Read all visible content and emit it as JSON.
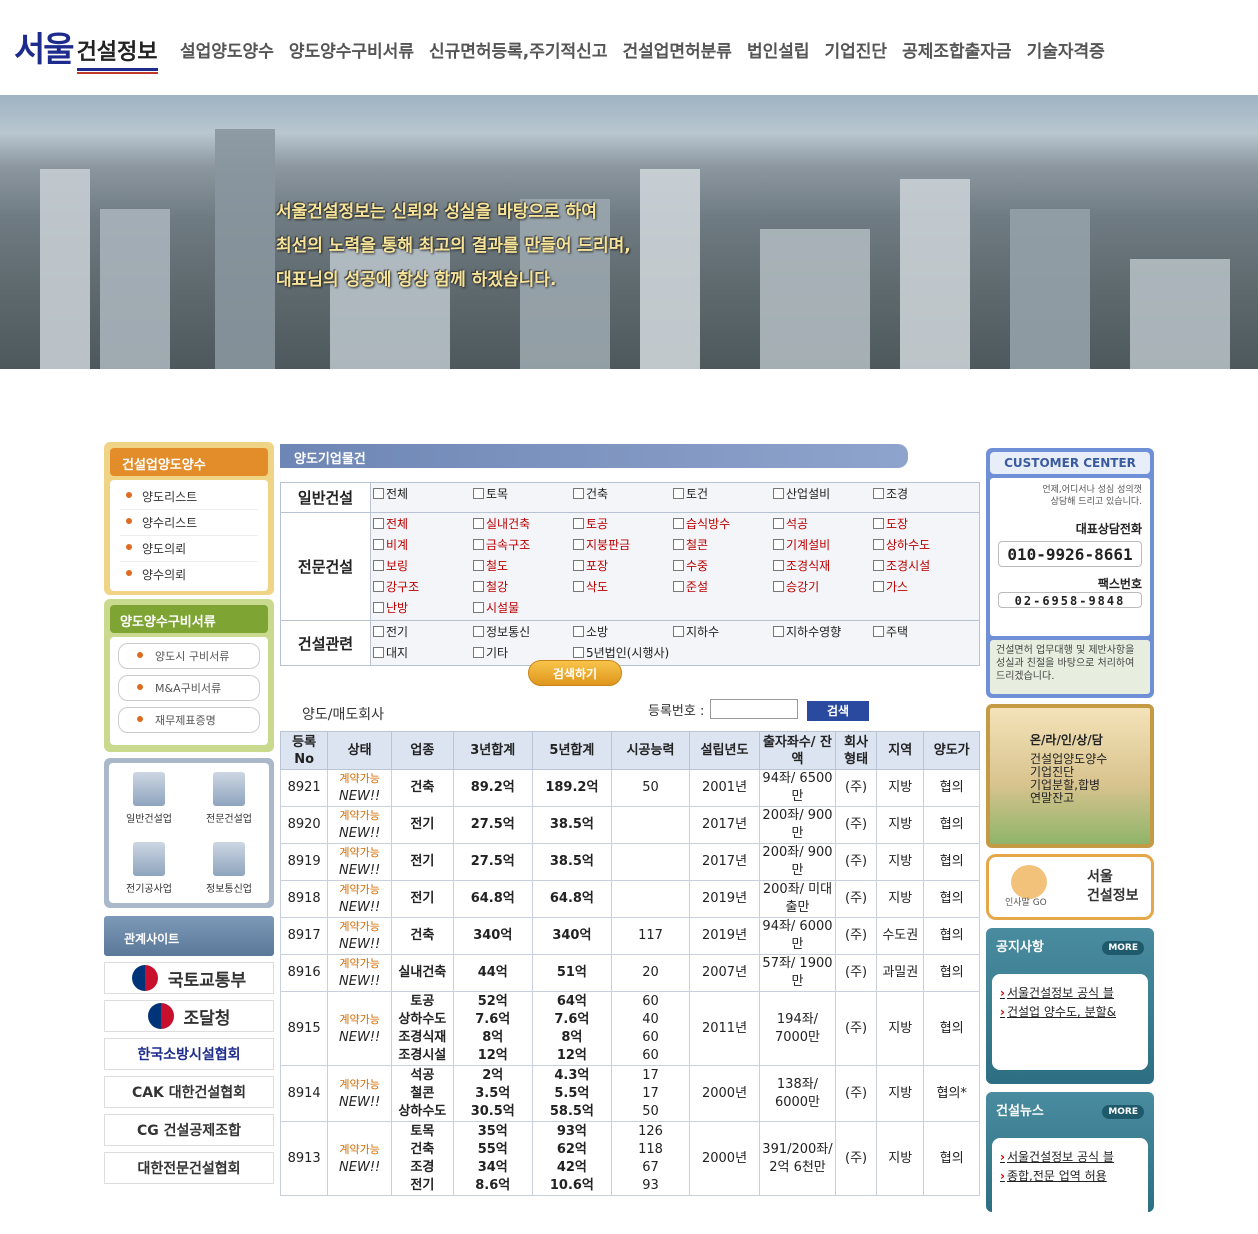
{
  "header": {
    "logo_main": "서울",
    "logo_sub": "건설정보",
    "nav": [
      "설업양도양수",
      "양도양수구비서류",
      "신규면허등록,주기적신고",
      "건설업면허분류",
      "법인설립",
      "기업진단",
      "공제조합출자금",
      "기술자격증"
    ]
  },
  "hero": {
    "lines": [
      "서울건설정보는 신뢰와 성실을 바탕으로 하여",
      "최선의 노력을 통해 최고의 결과를 만들어 드리며,",
      "대표님의 성공에 항상 함께 하겠습니다."
    ]
  },
  "left": {
    "box1": {
      "title": "건설업양도양수",
      "items": [
        "양도리스트",
        "양수리스트",
        "양도의뢰",
        "양수의뢰"
      ]
    },
    "box2": {
      "title": "양도양수구비서류",
      "items": [
        "양도시 구비서류",
        "M&A구비서류",
        "재무제표증명"
      ]
    },
    "box3": {
      "items": [
        "일반건설업",
        "전문건설업",
        "전기공사업",
        "정보통신업"
      ]
    },
    "related_title": "관계사이트",
    "related": [
      "국토교통부",
      "조달청",
      "한국소방시설협회",
      "CAK 대한건설협회",
      "CG 건설공제조합",
      "대한전문건설협회"
    ]
  },
  "main": {
    "title": "양도기업물건",
    "filters": {
      "general": {
        "label": "일반건설",
        "items": [
          "전체",
          "토목",
          "건축",
          "토건",
          "산업설비",
          "조경"
        ]
      },
      "special": {
        "label": "전문건설",
        "items": [
          "전체",
          "실내건축",
          "토공",
          "습식방수",
          "석공",
          "도장",
          "비계",
          "금속구조",
          "지붕판금",
          "철콘",
          "기계설비",
          "상하수도",
          "보링",
          "철도",
          "포장",
          "수중",
          "조경식재",
          "조경시설",
          "강구조",
          "철강",
          "삭도",
          "준설",
          "승강기",
          "가스",
          "난방",
          "시설물"
        ]
      },
      "related": {
        "label": "건설관련",
        "items": [
          "전기",
          "정보통신",
          "소방",
          "지하수",
          "지하수영향",
          "주택",
          "대지",
          "기타",
          "5년법인(시행사)"
        ]
      }
    },
    "search_label": "검색하기",
    "list_label": "양도/매도회사",
    "reg_label": "등록번호 :",
    "reg_button": "검색",
    "columns": [
      "등록 No",
      "상태",
      "업종",
      "3년합계",
      "5년합계",
      "시공능력",
      "설립년도",
      "출자좌수/ 잔액",
      "회사 형태",
      "지역",
      "양도가"
    ],
    "status_text": "계약가능",
    "status_badge": "NEW!!",
    "rows": [
      {
        "no": "8921",
        "type": [
          "건축"
        ],
        "y3": [
          "89.2억"
        ],
        "y5": [
          "189.2억"
        ],
        "cap": [
          "50"
        ],
        "year": "2001년",
        "shares": "94좌/ 6500만",
        "form": "(주)",
        "region": "지방",
        "price": "협의"
      },
      {
        "no": "8920",
        "type": [
          "전기"
        ],
        "y3": [
          "27.5억"
        ],
        "y5": [
          "38.5억"
        ],
        "cap": [
          ""
        ],
        "year": "2017년",
        "shares": "200좌/ 900만",
        "form": "(주)",
        "region": "지방",
        "price": "협의"
      },
      {
        "no": "8919",
        "type": [
          "전기"
        ],
        "y3": [
          "27.5억"
        ],
        "y5": [
          "38.5억"
        ],
        "cap": [
          ""
        ],
        "year": "2017년",
        "shares": "200좌/ 900만",
        "form": "(주)",
        "region": "지방",
        "price": "협의"
      },
      {
        "no": "8918",
        "type": [
          "전기"
        ],
        "y3": [
          "64.8억"
        ],
        "y5": [
          "64.8억"
        ],
        "cap": [
          ""
        ],
        "year": "2019년",
        "shares": "200좌/ 미대출만",
        "form": "(주)",
        "region": "지방",
        "price": "협의"
      },
      {
        "no": "8917",
        "type": [
          "건축"
        ],
        "y3": [
          "340억"
        ],
        "y5": [
          "340억"
        ],
        "cap": [
          "117"
        ],
        "year": "2019년",
        "shares": "94좌/ 6000만",
        "form": "(주)",
        "region": "수도권",
        "price": "협의"
      },
      {
        "no": "8916",
        "type": [
          "실내건축"
        ],
        "y3": [
          "44억"
        ],
        "y5": [
          "51억"
        ],
        "cap": [
          "20"
        ],
        "year": "2007년",
        "shares": "57좌/ 1900만",
        "form": "(주)",
        "region": "과밀권",
        "price": "협의"
      },
      {
        "no": "8915",
        "type": [
          "토공",
          "상하수도",
          "조경식재",
          "조경시설"
        ],
        "y3": [
          "52억",
          "7.6억",
          "8억",
          "12억"
        ],
        "y5": [
          "64억",
          "7.6억",
          "8억",
          "12억"
        ],
        "cap": [
          "60",
          "40",
          "60",
          "60"
        ],
        "year": "2011년",
        "shares": "194좌/ 7000만",
        "form": "(주)",
        "region": "지방",
        "price": "협의"
      },
      {
        "no": "8914",
        "type": [
          "석공",
          "철콘",
          "상하수도"
        ],
        "y3": [
          "2억",
          "3.5억",
          "30.5억"
        ],
        "y5": [
          "4.3억",
          "5.5억",
          "58.5억"
        ],
        "cap": [
          "17",
          "17",
          "50"
        ],
        "year": "2000년",
        "shares": "138좌/ 6000만",
        "form": "(주)",
        "region": "지방",
        "price": "협의*"
      },
      {
        "no": "8913",
        "type": [
          "토목",
          "건축",
          "조경",
          "전기"
        ],
        "y3": [
          "35억",
          "55억",
          "34억",
          "8.6억"
        ],
        "y5": [
          "93억",
          "62억",
          "42억",
          "10.6억"
        ],
        "cap": [
          "126",
          "118",
          "67",
          "93"
        ],
        "year": "2000년",
        "shares": "391/200좌/ 2억 6천만",
        "form": "(주)",
        "region": "지방",
        "price": "협의"
      }
    ]
  },
  "right": {
    "cc_title": "CUSTOMER CENTER",
    "cc_small": "언제,어디서나 성심 성의껏 상담해 드리고 있습니다.",
    "cc_phone_label": "대표상담전화",
    "cc_phone": "010-9926-8661",
    "cc_fax_label": "팩스번호",
    "cc_fax": "02-6958-9848",
    "cc_foot": "건설면허 업무대행 및 제반사항을 성실과 친절을 바탕으로 처리하여 드리겠습니다.",
    "online_title": "온/라/인/상/담",
    "online_items": [
      "건설업양도양수",
      "기업진단",
      "기업분할,합병",
      "연말잔고"
    ],
    "seoul_lines": [
      "서울",
      "건설정보"
    ],
    "seoul_label": "인사말 GO",
    "notice_title": "공지사항",
    "more": "MORE",
    "notice": [
      "서울건설정보 공식 블",
      "건설업 양수도, 분할&"
    ],
    "news_title": "건설뉴스",
    "news": [
      "서울건설정보 공식 블",
      "종합,전문 업역 허용"
    ]
  }
}
